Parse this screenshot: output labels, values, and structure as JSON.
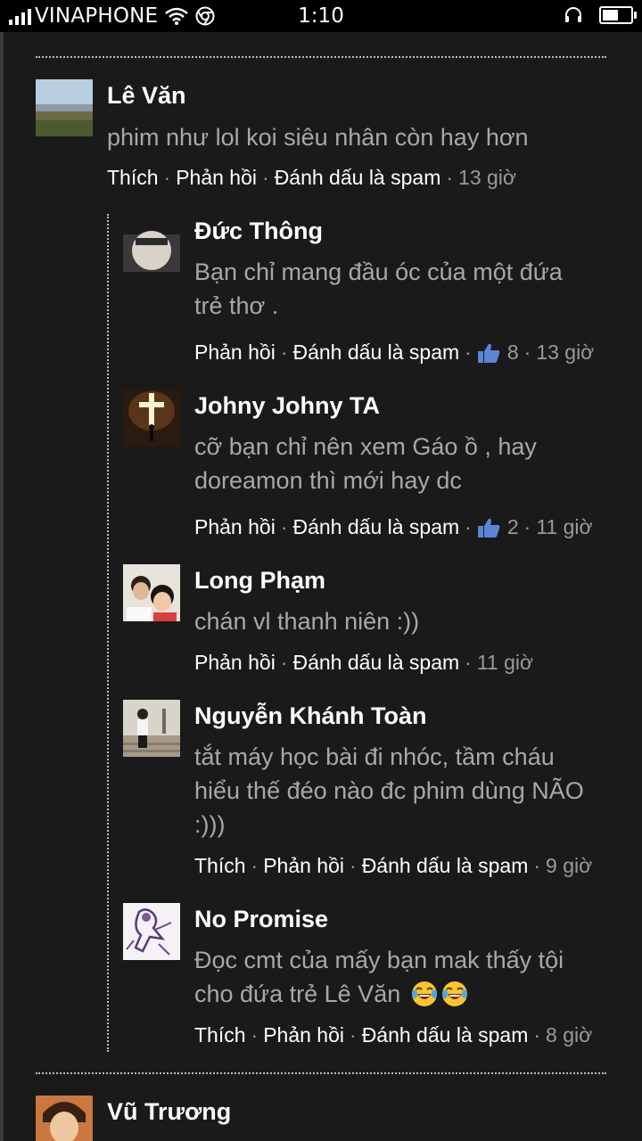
{
  "status_bar": {
    "carrier": "VINAPHONE",
    "time": "1:10",
    "battery_level": 0.55
  },
  "actions": {
    "like": "Thích",
    "reply": "Phản hồi",
    "spam": "Đánh dấu là spam",
    "separator": "·"
  },
  "comments": [
    {
      "name": "Lê Văn",
      "text": "phim như lol koi siêu nhân còn hay hơn",
      "time": "13 giờ"
    },
    {
      "name": "Đức Thông",
      "text_lines": [
        "Bạn chỉ mang đầu óc của một đứa",
        "trẻ thơ ."
      ],
      "likes": "8",
      "time": "13 giờ"
    },
    {
      "name": "Johny Johny TA",
      "text_lines": [
        "cỡ bạn chỉ nên xem Gáo ồ , hay",
        "doreamon thì mới hay dc"
      ],
      "likes": "2",
      "time": "11 giờ"
    },
    {
      "name": "Long Phạm",
      "text": "chán vl thanh niên :))",
      "time": "11 giờ"
    },
    {
      "name": "Nguyễn Khánh Toàn",
      "text_lines": [
        "tắt máy học bài đi nhóc, tầm cháu",
        "hiểu thế đéo nào đc phim dùng NÃO",
        ":)))"
      ],
      "time": "9 giờ"
    },
    {
      "name": "No Promise",
      "text_lines": [
        "Đọc cmt của mấy bạn mak thấy tội",
        "cho đứa trẻ Lê Văn"
      ],
      "time": "8 giờ"
    },
    {
      "name": "Vũ Trương"
    }
  ]
}
